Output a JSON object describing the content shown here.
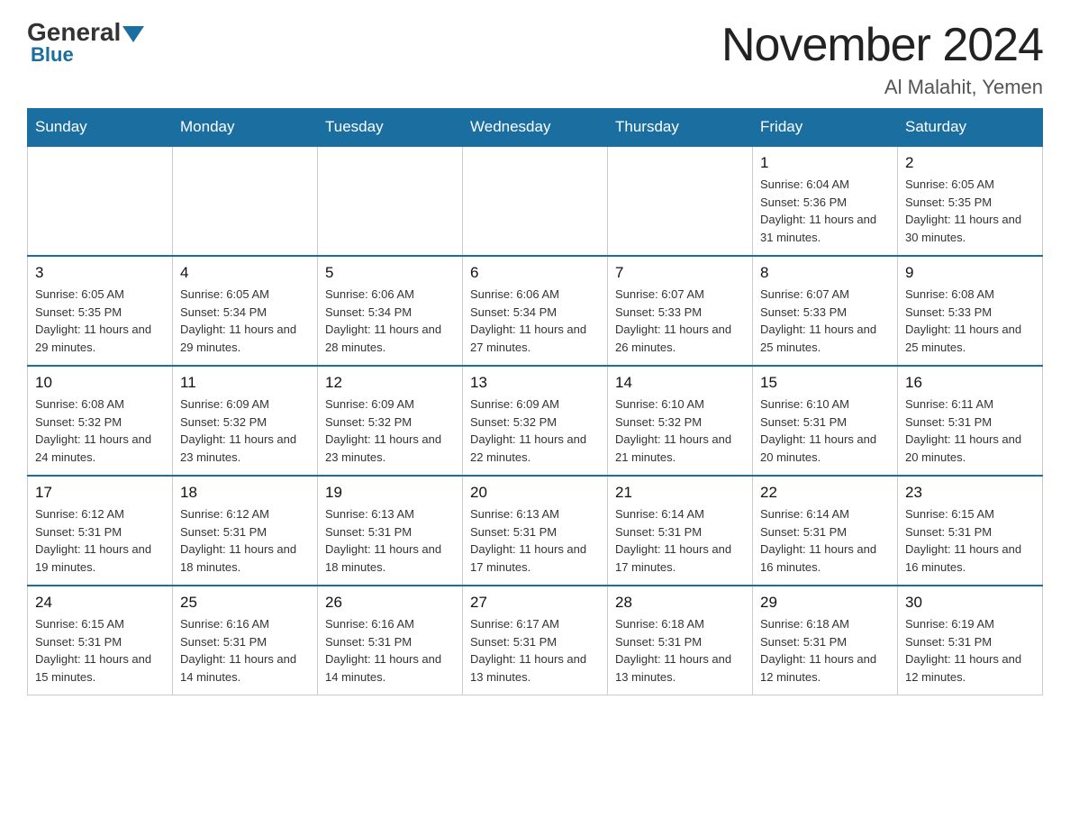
{
  "header": {
    "logo_general": "General",
    "logo_blue": "Blue",
    "month_title": "November 2024",
    "location": "Al Malahit, Yemen"
  },
  "days_of_week": [
    "Sunday",
    "Monday",
    "Tuesday",
    "Wednesday",
    "Thursday",
    "Friday",
    "Saturday"
  ],
  "weeks": [
    {
      "days": [
        {
          "num": "",
          "info": ""
        },
        {
          "num": "",
          "info": ""
        },
        {
          "num": "",
          "info": ""
        },
        {
          "num": "",
          "info": ""
        },
        {
          "num": "",
          "info": ""
        },
        {
          "num": "1",
          "info": "Sunrise: 6:04 AM\nSunset: 5:36 PM\nDaylight: 11 hours and 31 minutes."
        },
        {
          "num": "2",
          "info": "Sunrise: 6:05 AM\nSunset: 5:35 PM\nDaylight: 11 hours and 30 minutes."
        }
      ]
    },
    {
      "days": [
        {
          "num": "3",
          "info": "Sunrise: 6:05 AM\nSunset: 5:35 PM\nDaylight: 11 hours and 29 minutes."
        },
        {
          "num": "4",
          "info": "Sunrise: 6:05 AM\nSunset: 5:34 PM\nDaylight: 11 hours and 29 minutes."
        },
        {
          "num": "5",
          "info": "Sunrise: 6:06 AM\nSunset: 5:34 PM\nDaylight: 11 hours and 28 minutes."
        },
        {
          "num": "6",
          "info": "Sunrise: 6:06 AM\nSunset: 5:34 PM\nDaylight: 11 hours and 27 minutes."
        },
        {
          "num": "7",
          "info": "Sunrise: 6:07 AM\nSunset: 5:33 PM\nDaylight: 11 hours and 26 minutes."
        },
        {
          "num": "8",
          "info": "Sunrise: 6:07 AM\nSunset: 5:33 PM\nDaylight: 11 hours and 25 minutes."
        },
        {
          "num": "9",
          "info": "Sunrise: 6:08 AM\nSunset: 5:33 PM\nDaylight: 11 hours and 25 minutes."
        }
      ]
    },
    {
      "days": [
        {
          "num": "10",
          "info": "Sunrise: 6:08 AM\nSunset: 5:32 PM\nDaylight: 11 hours and 24 minutes."
        },
        {
          "num": "11",
          "info": "Sunrise: 6:09 AM\nSunset: 5:32 PM\nDaylight: 11 hours and 23 minutes."
        },
        {
          "num": "12",
          "info": "Sunrise: 6:09 AM\nSunset: 5:32 PM\nDaylight: 11 hours and 23 minutes."
        },
        {
          "num": "13",
          "info": "Sunrise: 6:09 AM\nSunset: 5:32 PM\nDaylight: 11 hours and 22 minutes."
        },
        {
          "num": "14",
          "info": "Sunrise: 6:10 AM\nSunset: 5:32 PM\nDaylight: 11 hours and 21 minutes."
        },
        {
          "num": "15",
          "info": "Sunrise: 6:10 AM\nSunset: 5:31 PM\nDaylight: 11 hours and 20 minutes."
        },
        {
          "num": "16",
          "info": "Sunrise: 6:11 AM\nSunset: 5:31 PM\nDaylight: 11 hours and 20 minutes."
        }
      ]
    },
    {
      "days": [
        {
          "num": "17",
          "info": "Sunrise: 6:12 AM\nSunset: 5:31 PM\nDaylight: 11 hours and 19 minutes."
        },
        {
          "num": "18",
          "info": "Sunrise: 6:12 AM\nSunset: 5:31 PM\nDaylight: 11 hours and 18 minutes."
        },
        {
          "num": "19",
          "info": "Sunrise: 6:13 AM\nSunset: 5:31 PM\nDaylight: 11 hours and 18 minutes."
        },
        {
          "num": "20",
          "info": "Sunrise: 6:13 AM\nSunset: 5:31 PM\nDaylight: 11 hours and 17 minutes."
        },
        {
          "num": "21",
          "info": "Sunrise: 6:14 AM\nSunset: 5:31 PM\nDaylight: 11 hours and 17 minutes."
        },
        {
          "num": "22",
          "info": "Sunrise: 6:14 AM\nSunset: 5:31 PM\nDaylight: 11 hours and 16 minutes."
        },
        {
          "num": "23",
          "info": "Sunrise: 6:15 AM\nSunset: 5:31 PM\nDaylight: 11 hours and 16 minutes."
        }
      ]
    },
    {
      "days": [
        {
          "num": "24",
          "info": "Sunrise: 6:15 AM\nSunset: 5:31 PM\nDaylight: 11 hours and 15 minutes."
        },
        {
          "num": "25",
          "info": "Sunrise: 6:16 AM\nSunset: 5:31 PM\nDaylight: 11 hours and 14 minutes."
        },
        {
          "num": "26",
          "info": "Sunrise: 6:16 AM\nSunset: 5:31 PM\nDaylight: 11 hours and 14 minutes."
        },
        {
          "num": "27",
          "info": "Sunrise: 6:17 AM\nSunset: 5:31 PM\nDaylight: 11 hours and 13 minutes."
        },
        {
          "num": "28",
          "info": "Sunrise: 6:18 AM\nSunset: 5:31 PM\nDaylight: 11 hours and 13 minutes."
        },
        {
          "num": "29",
          "info": "Sunrise: 6:18 AM\nSunset: 5:31 PM\nDaylight: 11 hours and 12 minutes."
        },
        {
          "num": "30",
          "info": "Sunrise: 6:19 AM\nSunset: 5:31 PM\nDaylight: 11 hours and 12 minutes."
        }
      ]
    }
  ]
}
